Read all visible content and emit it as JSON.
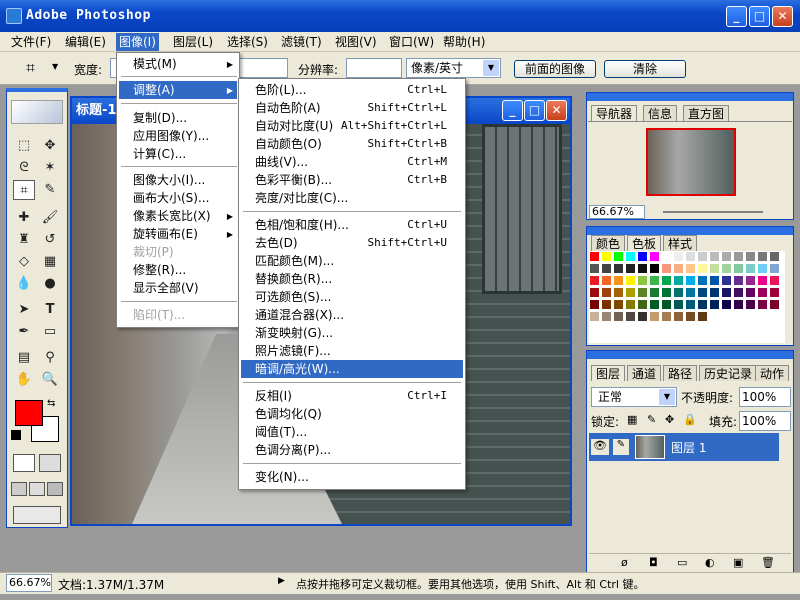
{
  "app": {
    "title": "Adobe Photoshop"
  },
  "window_buttons": {
    "minimize": "_",
    "maximize": "□",
    "close": "✕"
  },
  "menubar": {
    "items": [
      "文件(F)",
      "编辑(E)",
      "图像(I)",
      "图层(L)",
      "选择(S)",
      "滤镜(T)",
      "视图(V)",
      "窗口(W)",
      "帮助(H)"
    ]
  },
  "options": {
    "width_label": "宽度:",
    "resolution_label": "分辨率:",
    "unit": "像素/英寸",
    "front_image": "前面的图像",
    "clear": "清除"
  },
  "document": {
    "title": "标题-1"
  },
  "image_menu": {
    "items": [
      "模式(M)",
      "调整(A)",
      "复制(D)...",
      "应用图像(Y)...",
      "计算(C)...",
      "图像大小(I)...",
      "画布大小(S)...",
      "像素长宽比(X)",
      "旋转画布(E)",
      "裁切(P)",
      "修整(R)...",
      "显示全部(V)",
      "陷印(T)..."
    ]
  },
  "adjust_menu": {
    "items": [
      {
        "label": "色阶(L)...",
        "sc": "Ctrl+L"
      },
      {
        "label": "自动色阶(A)",
        "sc": "Shift+Ctrl+L"
      },
      {
        "label": "自动对比度(U)",
        "sc": "Alt+Shift+Ctrl+L"
      },
      {
        "label": "自动颜色(O)",
        "sc": "Shift+Ctrl+B"
      },
      {
        "label": "曲线(V)...",
        "sc": "Ctrl+M"
      },
      {
        "label": "色彩平衡(B)...",
        "sc": "Ctrl+B"
      },
      {
        "label": "亮度/对比度(C)...",
        "sc": ""
      },
      {
        "label": "色相/饱和度(H)...",
        "sc": "Ctrl+U"
      },
      {
        "label": "去色(D)",
        "sc": "Shift+Ctrl+U"
      },
      {
        "label": "匹配颜色(M)...",
        "sc": ""
      },
      {
        "label": "替换颜色(R)...",
        "sc": ""
      },
      {
        "label": "可选颜色(S)...",
        "sc": ""
      },
      {
        "label": "通道混合器(X)...",
        "sc": ""
      },
      {
        "label": "渐变映射(G)...",
        "sc": ""
      },
      {
        "label": "照片滤镜(F)...",
        "sc": ""
      },
      {
        "label": "暗调/高光(W)...",
        "sc": ""
      },
      {
        "label": "反相(I)",
        "sc": "Ctrl+I"
      },
      {
        "label": "色调均化(Q)",
        "sc": ""
      },
      {
        "label": "阈值(T)...",
        "sc": ""
      },
      {
        "label": "色调分离(P)...",
        "sc": ""
      },
      {
        "label": "变化(N)...",
        "sc": ""
      }
    ]
  },
  "navigator": {
    "tabs": [
      "导航器",
      "信息",
      "直方图"
    ],
    "zoom": "66.67%"
  },
  "color_panel": {
    "tabs": [
      "颜色",
      "色板",
      "样式"
    ]
  },
  "layers": {
    "tabs": [
      "图层",
      "通道",
      "路径",
      "历史记录",
      "动作"
    ],
    "mode": "正常",
    "opacity_label": "不透明度:",
    "opacity": "100%",
    "lock_label": "锁定:",
    "fill_label": "填充:",
    "fill": "100%",
    "layer_name": "图层 1"
  },
  "status": {
    "zoom": "66.67%",
    "doc": "文档:1.37M/1.37M",
    "hint": "点按并拖移可定义裁切框。要用其他选项，使用 Shift、Alt 和 Ctrl 键。"
  },
  "colors": {
    "foreground": "#ff0000",
    "background": "#ffffff"
  }
}
